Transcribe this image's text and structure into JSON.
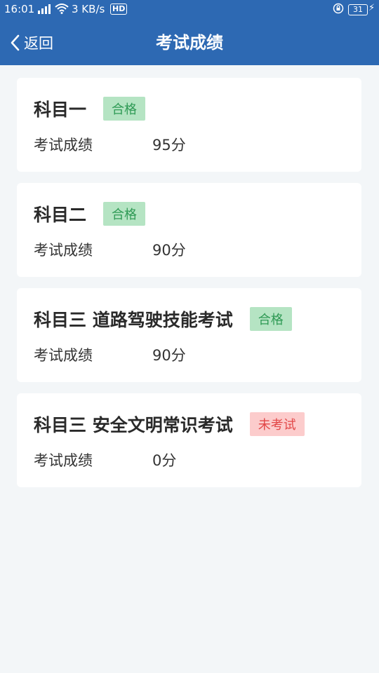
{
  "status_bar": {
    "time": "16:01",
    "network_speed": "3 KB/s",
    "hd_label": "HD",
    "battery_level": "31"
  },
  "header": {
    "back_label": "返回",
    "title": "考试成绩"
  },
  "results": [
    {
      "subject": "科目一",
      "status": "合格",
      "status_type": "pass",
      "score_label": "考试成绩",
      "score": "95分"
    },
    {
      "subject": "科目二",
      "status": "合格",
      "status_type": "pass",
      "score_label": "考试成绩",
      "score": "90分"
    },
    {
      "subject": "科目三 道路驾驶技能考试",
      "status": "合格",
      "status_type": "pass",
      "score_label": "考试成绩",
      "score": "90分"
    },
    {
      "subject": "科目三 安全文明常识考试",
      "status": "未考试",
      "status_type": "fail",
      "score_label": "考试成绩",
      "score": "0分"
    }
  ],
  "colors": {
    "header_bg": "#2d69b3",
    "page_bg": "#f3f6f8",
    "pass_badge_bg": "#b5e4c3",
    "pass_badge_text": "#2f9a55",
    "fail_badge_bg": "#fccccc",
    "fail_badge_text": "#e24848"
  }
}
